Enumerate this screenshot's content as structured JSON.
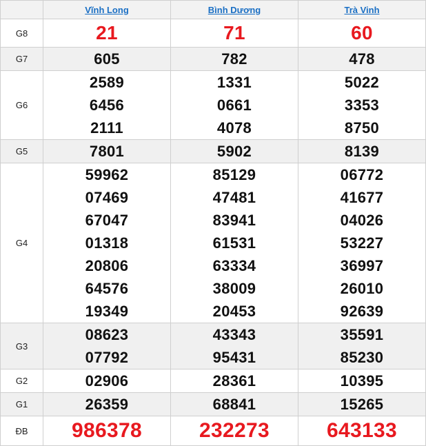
{
  "provinces": [
    "Vĩnh Long",
    "Bình Dương",
    "Trà Vinh"
  ],
  "prizes": [
    {
      "label": "G8",
      "values": [
        [
          "21"
        ],
        [
          "71"
        ],
        [
          "60"
        ]
      ]
    },
    {
      "label": "G7",
      "values": [
        [
          "605"
        ],
        [
          "782"
        ],
        [
          "478"
        ]
      ]
    },
    {
      "label": "G6",
      "values": [
        [
          "2589",
          "6456",
          "2111"
        ],
        [
          "1331",
          "0661",
          "4078"
        ],
        [
          "5022",
          "3353",
          "8750"
        ]
      ]
    },
    {
      "label": "G5",
      "values": [
        [
          "7801"
        ],
        [
          "5902"
        ],
        [
          "8139"
        ]
      ]
    },
    {
      "label": "G4",
      "values": [
        [
          "59962",
          "07469",
          "67047",
          "01318",
          "20806",
          "64576",
          "19349"
        ],
        [
          "85129",
          "47481",
          "83941",
          "61531",
          "63334",
          "38009",
          "20453"
        ],
        [
          "06772",
          "41677",
          "04026",
          "53227",
          "36997",
          "26010",
          "92639"
        ]
      ]
    },
    {
      "label": "G3",
      "values": [
        [
          "08623",
          "07792"
        ],
        [
          "43343",
          "95431"
        ],
        [
          "35591",
          "85230"
        ]
      ]
    },
    {
      "label": "G2",
      "values": [
        [
          "02906"
        ],
        [
          "28361"
        ],
        [
          "10395"
        ]
      ]
    },
    {
      "label": "G1",
      "values": [
        [
          "26359"
        ],
        [
          "68841"
        ],
        [
          "15265"
        ]
      ]
    },
    {
      "label": "ĐB",
      "values": [
        [
          "986378"
        ],
        [
          "232273"
        ],
        [
          "643133"
        ]
      ]
    }
  ],
  "colors": {
    "highlight": "#e8191f",
    "link": "#1a6fc4",
    "alt_row": "#f0f0f0"
  }
}
